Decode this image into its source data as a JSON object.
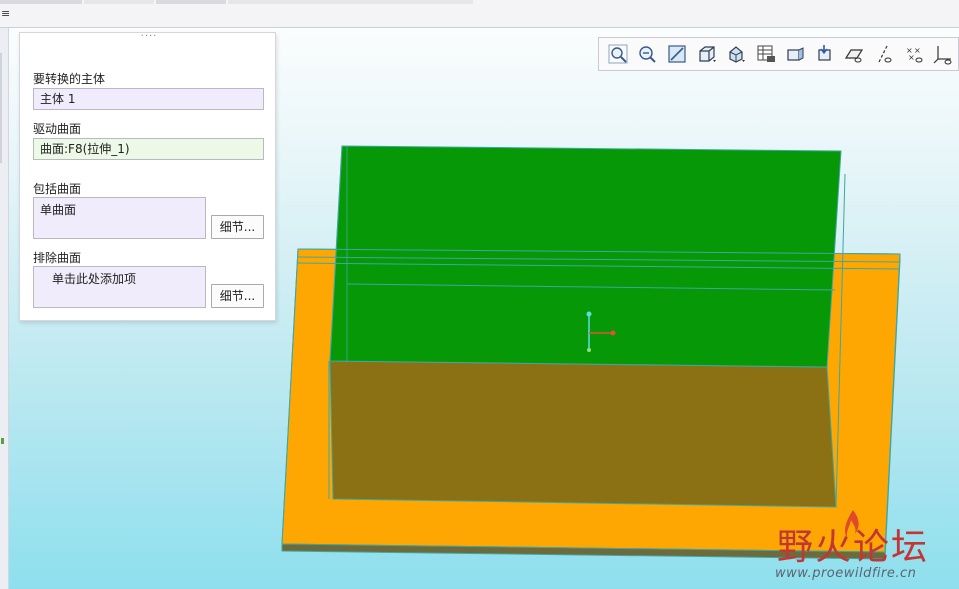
{
  "panel": {
    "body_label": "要转换的主体",
    "body_value": "主体 1",
    "driving_surface_label": "驱动曲面",
    "driving_surface_value": "曲面:F8(拉伸_1)",
    "include_surfaces_label": "包括曲面",
    "include_surfaces_value": "单曲面",
    "include_details_button": "细节...",
    "exclude_surfaces_label": "排除曲面",
    "exclude_surfaces_placeholder": "单击此处添加项",
    "exclude_details_button": "细节..."
  },
  "toolbar": {
    "icons": [
      "zoom-in-icon",
      "zoom-out-icon",
      "refit-icon",
      "display-style-icon",
      "saved-views-icon",
      "view-manager-icon",
      "perspective-icon",
      "spin-center-icon",
      "plane-display-icon",
      "axis-display-icon",
      "point-display-icon",
      "csys-display-icon"
    ]
  },
  "model": {
    "colors": {
      "green_surface": "#069806",
      "orange_base": "#fea703",
      "brown_face": "#8c7114",
      "edge": "#4aa7a0"
    }
  },
  "watermark": {
    "title": "野火论坛",
    "url": "www.proewildfire.cn"
  }
}
